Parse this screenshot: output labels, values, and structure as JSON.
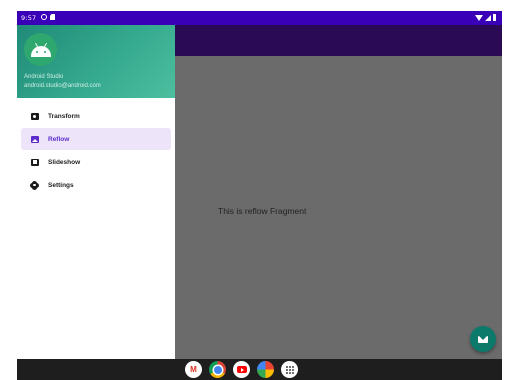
{
  "status_bar": {
    "time": "9:57",
    "icons": [
      "settings-circle-icon",
      "sd-card-icon",
      "wifi-icon",
      "signal-icon",
      "battery-icon"
    ]
  },
  "drawer": {
    "header": {
      "name": "Android Studio",
      "email": "android.studio@android.com",
      "avatar_icon": "android-icon"
    },
    "items": [
      {
        "label": "Transform",
        "icon": "camera-icon",
        "selected": false
      },
      {
        "label": "Reflow",
        "icon": "image-icon",
        "selected": true
      },
      {
        "label": "Slideshow",
        "icon": "slideshow-icon",
        "selected": false
      },
      {
        "label": "Settings",
        "icon": "gear-icon",
        "selected": false
      }
    ]
  },
  "content": {
    "text": "This is reflow Fragment"
  },
  "fab": {
    "icon": "mail-icon"
  },
  "dock": {
    "apps": [
      "gmail-icon",
      "chrome-icon",
      "youtube-icon",
      "photos-icon",
      "app-drawer-icon"
    ]
  },
  "colors": {
    "status_bar": "#3a00b8",
    "app_bar": "#2a0a55",
    "scrim": "#6b6b6b",
    "header_gradient_start": "#1f8a78",
    "header_gradient_end": "#4dbf9f",
    "selected_bg": "#ede4f9",
    "selected_text": "#5b2cc9",
    "fab": "#0b7a6b"
  }
}
